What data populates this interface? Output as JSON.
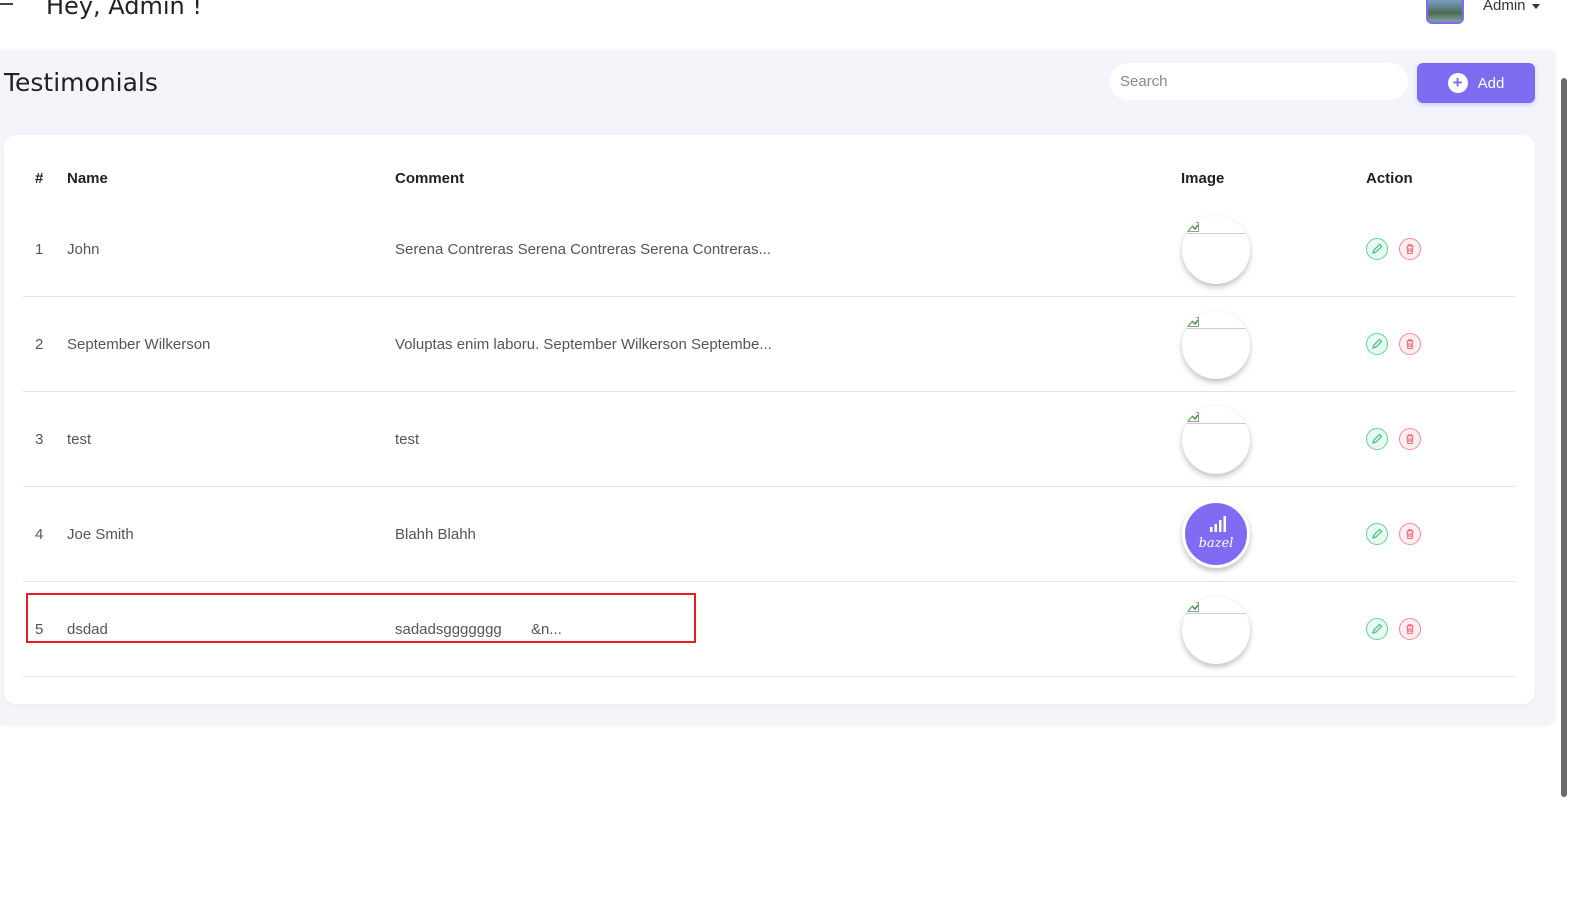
{
  "header": {
    "greeting": "Hey, Admin !",
    "user_label": "Admin"
  },
  "page": {
    "title": "Testimonials"
  },
  "search": {
    "placeholder": "Search"
  },
  "add_button": {
    "label": "Add"
  },
  "table": {
    "columns": [
      "#",
      "Name",
      "Comment",
      "Image",
      "Action"
    ],
    "rows": [
      {
        "index": "1",
        "name": "John",
        "comment": "Serena Contreras Serena Contreras Serena Contreras...",
        "image": "broken"
      },
      {
        "index": "2",
        "name": "September Wilkerson",
        "comment": "Voluptas enim laboru. September Wilkerson Septembe...",
        "image": "broken"
      },
      {
        "index": "3",
        "name": "test",
        "comment": "test",
        "image": "broken"
      },
      {
        "index": "4",
        "name": "Joe Smith",
        "comment": "Blahh Blahh",
        "image": "bazel-logo"
      },
      {
        "index": "5",
        "name": "dsdad",
        "comment": "sadadsggggggg       &n...",
        "image": "broken"
      }
    ],
    "brand_logo_text": "bazel"
  },
  "colors": {
    "accent": "#7b6cf0",
    "edit": "#5fd39b",
    "delete": "#f48a9a",
    "highlight": "#e81b23"
  }
}
